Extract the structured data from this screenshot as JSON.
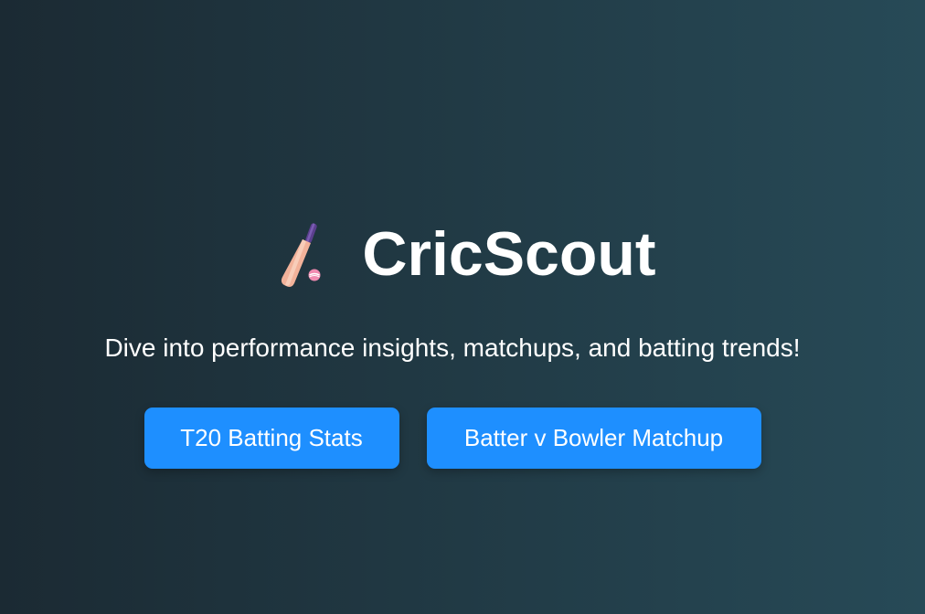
{
  "hero": {
    "title": "CricScout",
    "subtitle": "Dive into performance insights, matchups, and batting trends!",
    "icon": "cricket-bat-and-ball-icon"
  },
  "actions": {
    "batting_stats_label": "T20 Batting Stats",
    "matchup_label": "Batter v Bowler Matchup"
  },
  "colors": {
    "button": "#1e8fff",
    "background_start": "#1b2a33",
    "background_end": "#274a57",
    "text": "#ffffff"
  }
}
